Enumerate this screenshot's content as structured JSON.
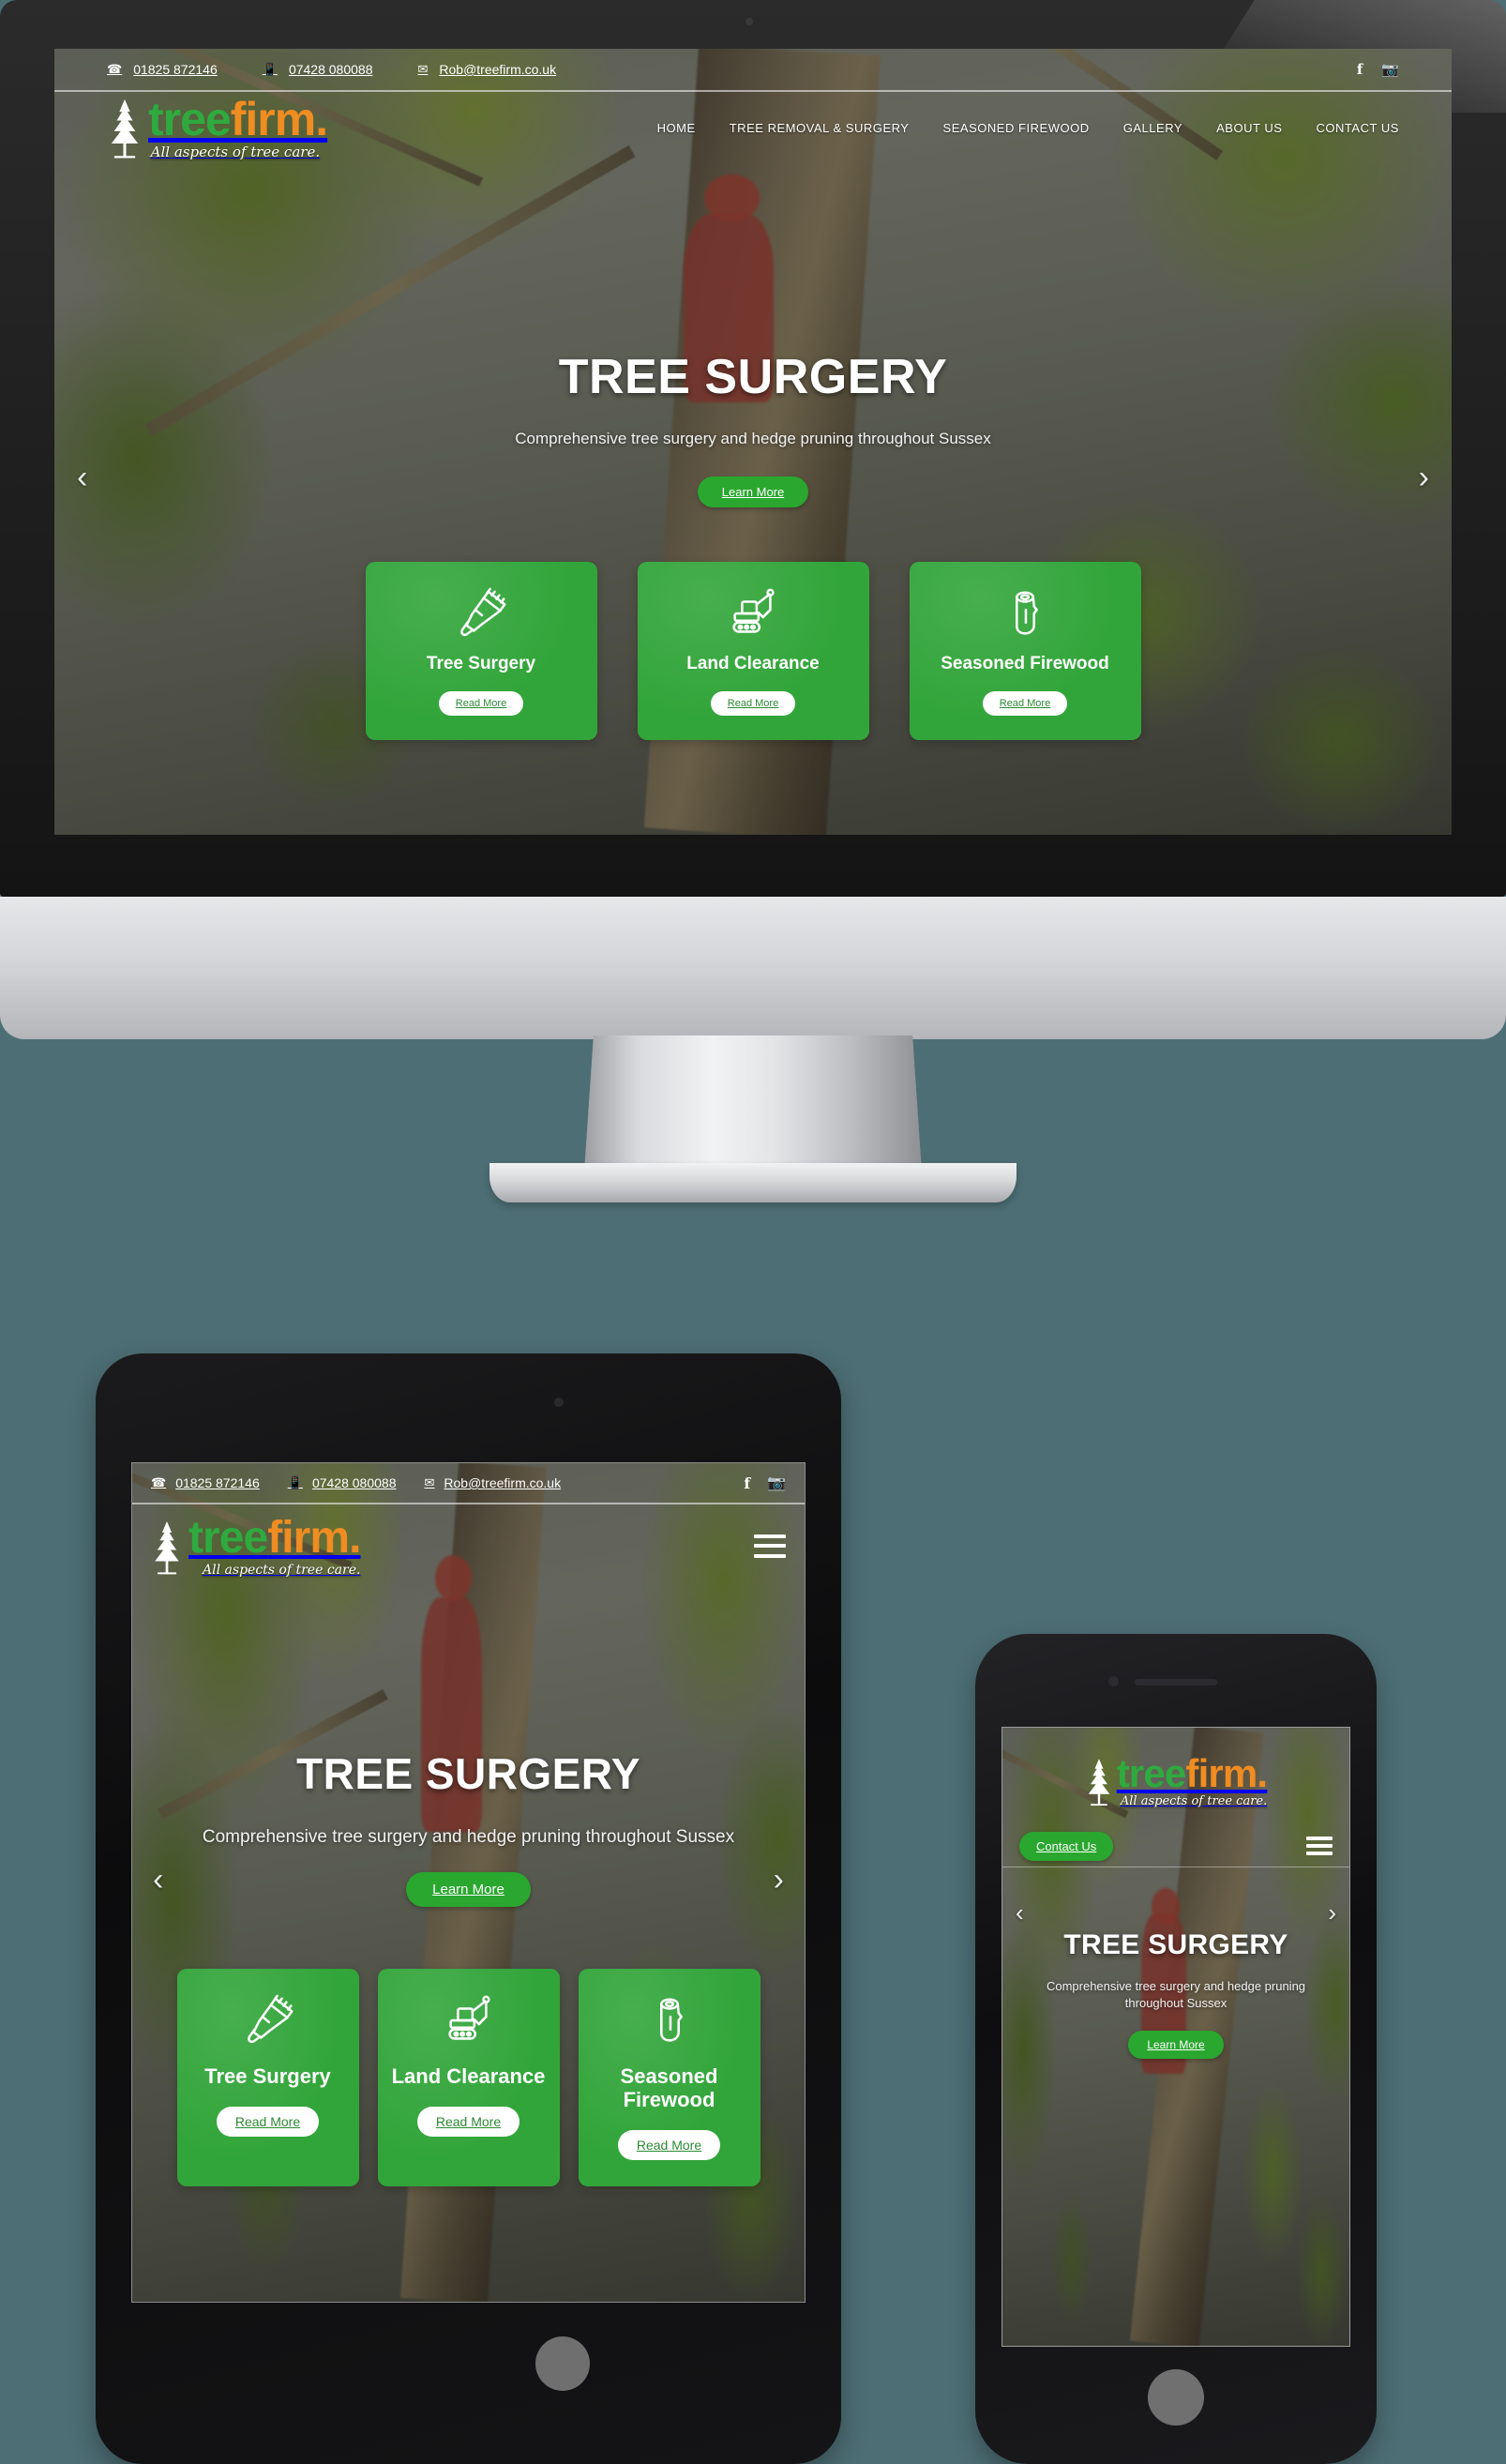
{
  "site": {
    "topbar": {
      "phone_landline": "01825 872146",
      "phone_mobile": "07428 080088",
      "email": "Rob@treefirm.co.uk",
      "phone_icon": "phone-icon",
      "mobile_icon": "mobile-icon",
      "email_icon": "envelope-icon",
      "facebook_icon": "facebook-icon",
      "instagram_icon": "instagram-icon"
    },
    "logo": {
      "word_green": "tree",
      "word_orange": "firm",
      "word_dot": ".",
      "tagline": "All aspects of tree care.",
      "green_hex": "#2faa3f",
      "orange_hex": "#ef8c22"
    },
    "nav": {
      "items": [
        {
          "label": "HOME"
        },
        {
          "label": "TREE REMOVAL & SURGERY"
        },
        {
          "label": "SEASONED FIREWOOD"
        },
        {
          "label": "GALLERY"
        },
        {
          "label": "ABOUT US"
        },
        {
          "label": "CONTACT US"
        }
      ]
    },
    "hero": {
      "title": "TREE SURGERY",
      "subtitle": "Comprehensive tree surgery and hedge pruning throughout Sussex",
      "cta_label": "Learn More",
      "prev_arrow": "‹",
      "next_arrow": "›",
      "cta_color_hex": "#2aa72f"
    },
    "cards": {
      "card_color_hex": "#32a53a",
      "items": [
        {
          "title": "Tree Surgery",
          "icon": "chainsaw-icon",
          "button": "Read More"
        },
        {
          "title": "Land Clearance",
          "icon": "excavator-icon",
          "button": "Read More"
        },
        {
          "title": "Seasoned Firewood",
          "icon": "log-icon",
          "button": "Read More"
        }
      ]
    },
    "mobile": {
      "menu_icon": "hamburger-menu-icon",
      "contact_label": "Contact Us"
    }
  },
  "mockup": {
    "background_hex": "#4d6e75",
    "devices": [
      {
        "name": "desktop-imac"
      },
      {
        "name": "tablet-ipad"
      },
      {
        "name": "phone-iphone"
      }
    ]
  }
}
